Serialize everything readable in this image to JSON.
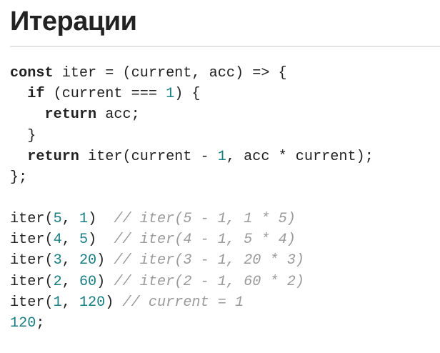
{
  "title": "Итерации",
  "code_function": [
    [
      {
        "t": "kw",
        "v": "const"
      },
      {
        "t": "p",
        "v": " iter = (current, acc) => {"
      }
    ],
    [
      {
        "t": "p",
        "v": "  "
      },
      {
        "t": "kw",
        "v": "if"
      },
      {
        "t": "p",
        "v": " (current === "
      },
      {
        "t": "num",
        "v": "1"
      },
      {
        "t": "p",
        "v": ") {"
      }
    ],
    [
      {
        "t": "p",
        "v": "    "
      },
      {
        "t": "kw",
        "v": "return"
      },
      {
        "t": "p",
        "v": " acc;"
      }
    ],
    [
      {
        "t": "p",
        "v": "  }"
      }
    ],
    [
      {
        "t": "p",
        "v": "  "
      },
      {
        "t": "kw",
        "v": "return"
      },
      {
        "t": "p",
        "v": " iter(current - "
      },
      {
        "t": "num",
        "v": "1"
      },
      {
        "t": "p",
        "v": ", acc * current);"
      }
    ],
    [
      {
        "t": "p",
        "v": "};"
      }
    ]
  ],
  "code_calls": [
    [
      {
        "t": "p",
        "v": "iter("
      },
      {
        "t": "num",
        "v": "5"
      },
      {
        "t": "p",
        "v": ", "
      },
      {
        "t": "num",
        "v": "1"
      },
      {
        "t": "p",
        "v": ")  "
      },
      {
        "t": "cm",
        "v": "// iter(5 - 1, 1 * 5)"
      }
    ],
    [
      {
        "t": "p",
        "v": "iter("
      },
      {
        "t": "num",
        "v": "4"
      },
      {
        "t": "p",
        "v": ", "
      },
      {
        "t": "num",
        "v": "5"
      },
      {
        "t": "p",
        "v": ")  "
      },
      {
        "t": "cm",
        "v": "// iter(4 - 1, 5 * 4)"
      }
    ],
    [
      {
        "t": "p",
        "v": "iter("
      },
      {
        "t": "num",
        "v": "3"
      },
      {
        "t": "p",
        "v": ", "
      },
      {
        "t": "num",
        "v": "20"
      },
      {
        "t": "p",
        "v": ") "
      },
      {
        "t": "cm",
        "v": "// iter(3 - 1, 20 * 3)"
      }
    ],
    [
      {
        "t": "p",
        "v": "iter("
      },
      {
        "t": "num",
        "v": "2"
      },
      {
        "t": "p",
        "v": ", "
      },
      {
        "t": "num",
        "v": "60"
      },
      {
        "t": "p",
        "v": ") "
      },
      {
        "t": "cm",
        "v": "// iter(2 - 1, 60 * 2)"
      }
    ],
    [
      {
        "t": "p",
        "v": "iter("
      },
      {
        "t": "num",
        "v": "1"
      },
      {
        "t": "p",
        "v": ", "
      },
      {
        "t": "num",
        "v": "120"
      },
      {
        "t": "p",
        "v": ") "
      },
      {
        "t": "cm",
        "v": "// current = 1"
      }
    ],
    [
      {
        "t": "num",
        "v": "120"
      },
      {
        "t": "p",
        "v": ";"
      }
    ]
  ],
  "colors": {
    "keyword": "#222222",
    "number": "#1a7f83",
    "comment": "#9a9a9a",
    "text": "#222222"
  }
}
